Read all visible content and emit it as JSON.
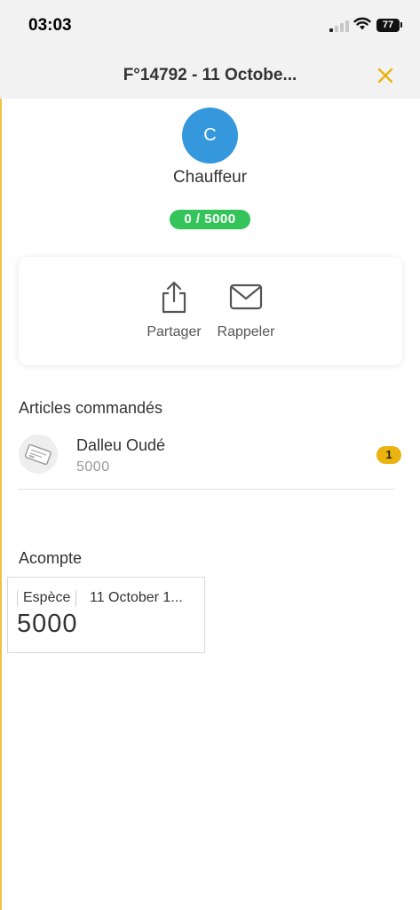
{
  "status_bar": {
    "time": "03:03",
    "battery": "77"
  },
  "header": {
    "title": "F°14792 - 11 Octobe..."
  },
  "profile": {
    "initial": "C",
    "name": "Chauffeur",
    "progress": "0 / 5000"
  },
  "actions": [
    {
      "label": "Partager",
      "icon": "share-icon"
    },
    {
      "label": "Rappeler",
      "icon": "mail-icon"
    }
  ],
  "articles": {
    "title": "Articles commandés",
    "items": [
      {
        "name": "Dalleu Oudé",
        "price": "5000",
        "quantity": "1",
        "icon": "ticket-icon"
      }
    ]
  },
  "acompte": {
    "title": "Acompte",
    "payments": [
      {
        "method": "Espèce",
        "date": "11 October 1...",
        "amount": "5000"
      }
    ]
  },
  "colors": {
    "accent": "#eab30f",
    "avatar": "#3597dc",
    "progress": "#34c45a"
  }
}
